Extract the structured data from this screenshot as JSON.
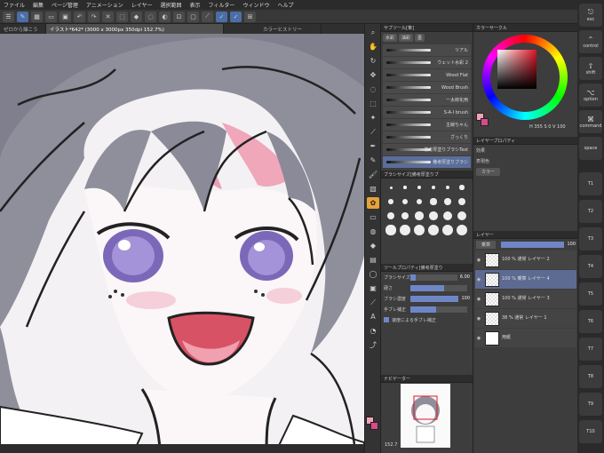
{
  "menu": [
    "ファイル",
    "編集",
    "ページ管理",
    "アニメーション",
    "レイヤー",
    "選択範囲",
    "表示",
    "フィルター",
    "ウィンドウ",
    "ヘルプ"
  ],
  "tabs": [
    "ゼロから描こう",
    "イラスト*642* (3000 x 3000px 350dpi 152.7%)",
    "カラーヒストリー"
  ],
  "subtool": {
    "header": "サブツール[筆]",
    "groups": [
      "水彩",
      "油彩",
      "墨"
    ],
    "brushes": [
      "リアル",
      "ウェット水彩 2",
      "Wood Flat",
      "Wood Brush",
      "一太郎化用",
      "S-A-I brush",
      "主線ちゃん",
      "ざっくり",
      "ふんわりA",
      "塗りブラシ",
      "備考厚塗りブラシTest",
      "備考厚塗りブラシ"
    ]
  },
  "brushsize": {
    "header": "ブラシサイズ[備考厚塗りブ",
    "sizes": [
      "0.7",
      "1",
      "1.5",
      "2",
      "2.5",
      "3",
      "4",
      "5",
      "6",
      "7",
      "8",
      "10",
      "12",
      "15",
      "17",
      "20",
      "25",
      "30",
      "40",
      "50",
      "60",
      "70",
      "80",
      "100"
    ]
  },
  "toolprop": {
    "header": "ツールプロパティ[備考厚塗り",
    "rows": [
      {
        "label": "ブラシサイズ",
        "value": "6.00",
        "fill": 0.12
      },
      {
        "label": "硬さ",
        "value": "",
        "fill": 0.6
      },
      {
        "label": "ブラシ濃度",
        "value": "100",
        "fill": 1.0
      },
      {
        "label": "手ブレ補正",
        "value": "",
        "fill": 0.45
      }
    ],
    "checkbox": "速度による手ブレ補正"
  },
  "navigator": {
    "header": "ナビゲーター",
    "zoom": "152.7"
  },
  "color": {
    "header": "カラーサークル",
    "hsv": "H 355 S 0 V 100",
    "main": "#f2a3b4",
    "sub": "#d84a8a"
  },
  "layerprop": {
    "header": "レイヤープロパティ",
    "effect": "効果",
    "expression": "表現色",
    "mode": "カラー"
  },
  "layers": {
    "header": "レイヤー",
    "blend": "乗算",
    "opacity": "100",
    "items": [
      {
        "line1": "100 % 通常",
        "line2": "レイヤー 2",
        "sel": false,
        "white": false
      },
      {
        "line1": "100 % 乗算",
        "line2": "レイヤー 4",
        "sel": true,
        "white": false
      },
      {
        "line1": "100 % 通常",
        "line2": "レイヤー 3",
        "sel": false,
        "white": false
      },
      {
        "line1": "38 % 通常",
        "line2": "レイヤー 1",
        "sel": false,
        "white": false
      },
      {
        "line1": "",
        "line2": "用紙",
        "sel": false,
        "white": true
      }
    ]
  },
  "keys": [
    {
      "icon": "⎋",
      "label": "esc"
    },
    {
      "icon": "⌃",
      "label": "control"
    },
    {
      "icon": "⇧",
      "label": "shift"
    },
    {
      "icon": "⌥",
      "label": "option"
    },
    {
      "icon": "⌘",
      "label": "command"
    },
    {
      "icon": "",
      "label": "space"
    },
    {
      "icon": "",
      "label": "T1"
    },
    {
      "icon": "",
      "label": "T2"
    },
    {
      "icon": "",
      "label": "T3"
    },
    {
      "icon": "",
      "label": "T4"
    },
    {
      "icon": "",
      "label": "T5"
    },
    {
      "icon": "",
      "label": "T6"
    },
    {
      "icon": "",
      "label": "T7"
    },
    {
      "icon": "",
      "label": "T8"
    },
    {
      "icon": "",
      "label": "T9"
    },
    {
      "icon": "",
      "label": "T10"
    }
  ]
}
